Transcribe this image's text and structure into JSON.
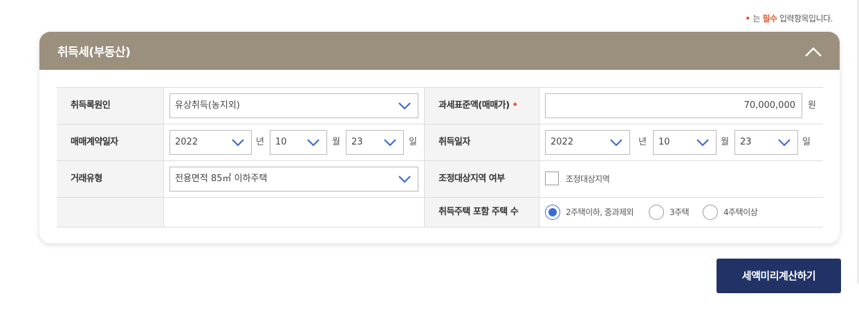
{
  "required_note": {
    "dot": "•",
    "prefix": "는",
    "emphasis": "필수",
    "suffix": "입력항목입니다."
  },
  "panel": {
    "title": "취득세(부동산)",
    "collapse_icon": "chevron-up-icon"
  },
  "form": {
    "acquisition_cause": {
      "label": "취득록원인",
      "value": "유상취득(농지외)"
    },
    "tax_base": {
      "label": "과세표준액(매매가)",
      "required_mark": "•",
      "value": "70,000,000",
      "unit": "원"
    },
    "contract_date": {
      "label": "매매계약일자",
      "year": "2022",
      "year_unit": "년",
      "month": "10",
      "month_unit": "월",
      "day": "23",
      "day_unit": "일"
    },
    "acquisition_date": {
      "label": "취득일자",
      "year": "2022",
      "year_unit": "년",
      "month": "10",
      "month_unit": "월",
      "day": "23",
      "day_unit": "일"
    },
    "transaction_type": {
      "label": "거래유형",
      "value": "전용면적 85㎡ 이하주택"
    },
    "adjustment_area": {
      "label": "조정대상지역 여부",
      "checkbox_label": "조정대상지역",
      "checked": false
    },
    "house_count": {
      "label": "취득주택 포함 주택 수",
      "options": [
        "2주택이하, 중과제외",
        "3주택",
        "4주택이상"
      ],
      "selected": 0
    }
  },
  "calc_button": {
    "label": "세액미리계산하기"
  },
  "colors": {
    "header_bg": "#9b8f7e",
    "button_bg": "#213366",
    "accent_blue": "#3b6bd6",
    "required_red": "#e4572e"
  }
}
